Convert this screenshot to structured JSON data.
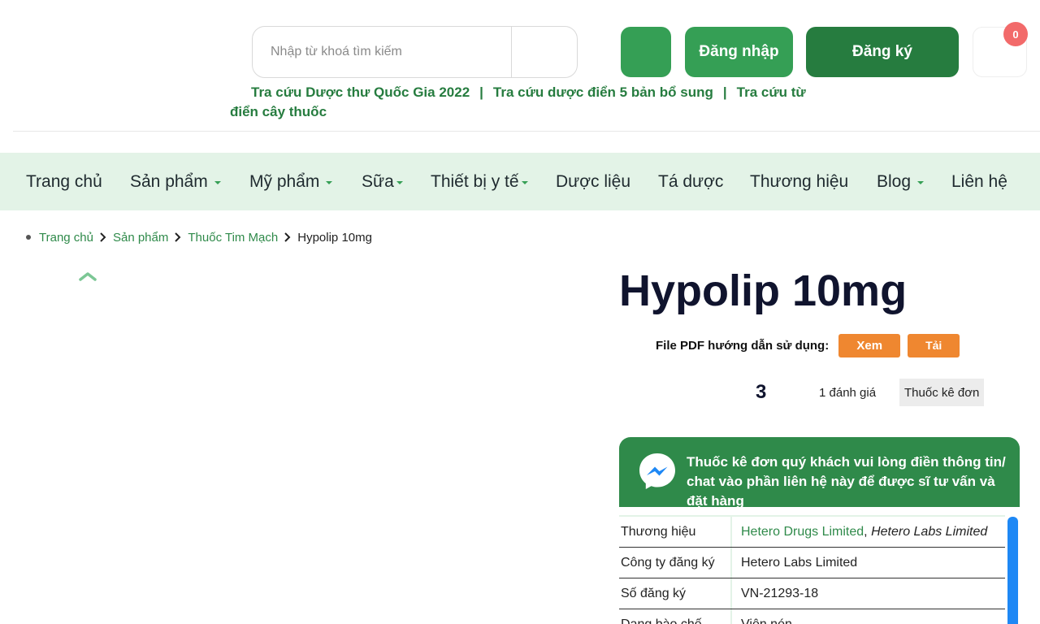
{
  "header": {
    "search_placeholder": "Nhập từ khoá tìm kiếm",
    "login_label": "Đăng nhập",
    "register_label": "Đăng ký",
    "cart_count": "0",
    "quick_links": [
      "Tra cứu Dược thư Quốc Gia 2022",
      "Tra cứu dược điển 5 bản bổ sung",
      "Tra cứu từ điển cây thuốc"
    ],
    "separator": "|"
  },
  "nav": {
    "items": [
      {
        "label": "Trang chủ"
      },
      {
        "label": "Sản phẩm"
      },
      {
        "label": "Mỹ phẩm"
      },
      {
        "label": "Sữa"
      },
      {
        "label": "Thiết bị y tế"
      },
      {
        "label": "Dược liệu"
      },
      {
        "label": "Tá dược"
      },
      {
        "label": "Thương hiệu"
      },
      {
        "label": "Blog"
      },
      {
        "label": "Liên hệ"
      }
    ]
  },
  "breadcrumb": [
    "Trang chủ",
    "Sản phẩm",
    "Thuốc Tim Mạch",
    "Hypolip 10mg"
  ],
  "product": {
    "title": "Hypolip 10mg",
    "pdf_label": "File PDF hướng dẫn sử dụng:",
    "view_label": "Xem",
    "download_label": "Tải",
    "rating": "3",
    "rating_count": "1 đánh giá",
    "rx_badge": "Thuốc kê đơn",
    "notice": "Thuốc kê đơn quý khách vui lòng điền thông tin/ chat vào phần liên hệ này để được sĩ tư vấn và đặt hàng",
    "info": [
      {
        "key": "Thương hiệu",
        "value_link": "Hetero Drugs Limited",
        "value_sep": ", ",
        "value_italic": "Hetero Labs Limited"
      },
      {
        "key": "Công ty đăng ký",
        "value": "Hetero Labs Limited"
      },
      {
        "key": "Số đăng ký",
        "value": "VN-21293-18"
      },
      {
        "key": "Dạng bào chế",
        "value": "Viên nén"
      }
    ]
  },
  "colors": {
    "brand_green": "#359f55",
    "dark_green": "#267c3f",
    "nav_bg": "#e3f3e7",
    "orange": "#ef8730",
    "badge_red": "#f26a6a",
    "scrollbar_blue": "#1e88f5"
  },
  "icons": {
    "gallery_up": "chevron-up-icon",
    "messenger": "messenger-icon",
    "breadcrumb_sep": "chevron-right-icon",
    "nav_caret": "caret-down-icon"
  }
}
